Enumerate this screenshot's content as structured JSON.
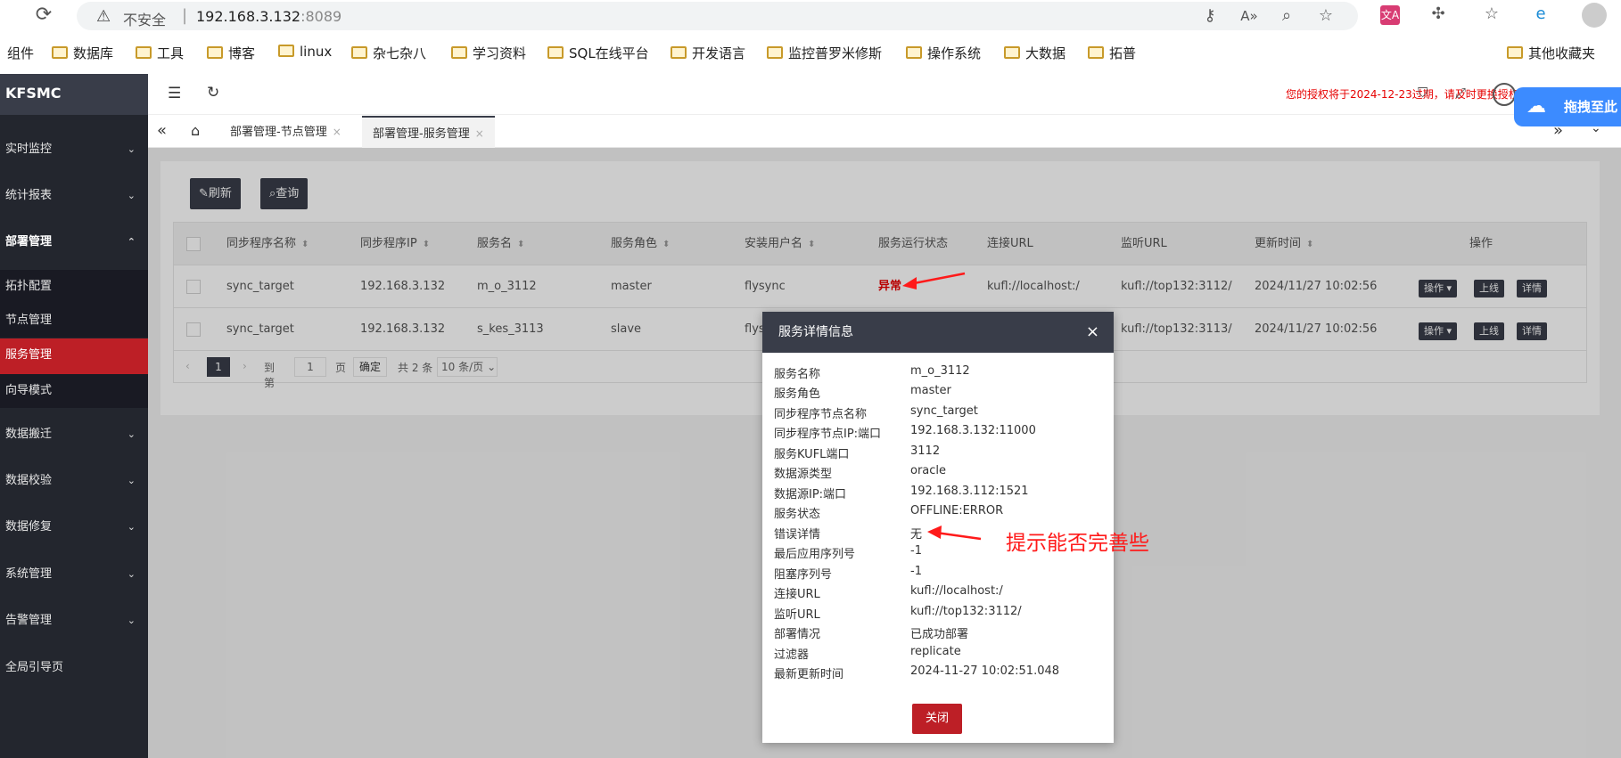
{
  "browser": {
    "insecure_label": "不安全",
    "url_host": "192.168.3.132",
    "url_port": ":8089"
  },
  "bookmarks": [
    "组件",
    "数据库",
    "工具",
    "博客",
    "linux",
    "杂七杂八",
    "学习资料",
    "SQL在线平台",
    "开发语言",
    "监控普罗米修斯",
    "操作系统",
    "大数据",
    "拓普"
  ],
  "bookmarks_other": "其他收藏夹",
  "sidebar": {
    "brand": "KFSMC",
    "items": [
      {
        "label": "实时监控",
        "chev": "⌄"
      },
      {
        "label": "统计报表",
        "chev": "⌄"
      },
      {
        "label": "部署管理",
        "chev": "⌃"
      },
      {
        "label": "数据搬迁",
        "chev": "⌄"
      },
      {
        "label": "数据校验",
        "chev": "⌄"
      },
      {
        "label": "数据修复",
        "chev": "⌄"
      },
      {
        "label": "系统管理",
        "chev": "⌄"
      },
      {
        "label": "告警管理",
        "chev": "⌄"
      },
      {
        "label": "全局引导页",
        "chev": ""
      }
    ],
    "sub_items": [
      "拓扑配置",
      "节点管理",
      "服务管理",
      "向导模式"
    ]
  },
  "header": {
    "license_notice": "您的授权将于2024-12-23过期，请及时更换授权文件"
  },
  "tabs": [
    {
      "label": "部署管理-节点管理",
      "close": "×"
    },
    {
      "label": "部署管理-服务管理",
      "close": "×"
    }
  ],
  "toolbar": {
    "refresh_label": "刷新",
    "query_label": "查询"
  },
  "table": {
    "headers": [
      "同步程序名称",
      "同步程序IP",
      "服务名",
      "服务角色",
      "安装用户名",
      "服务运行状态",
      "连接URL",
      "监听URL",
      "更新时间",
      "操作"
    ],
    "rows": [
      {
        "name": "sync_target",
        "ip": "192.168.3.132",
        "service": "m_o_3112",
        "role": "master",
        "user": "flysync",
        "status": "异常",
        "conn": "kufl://localhost:/",
        "listen": "kufl://top132:3112/",
        "time": "2024/11/27 10:02:56"
      },
      {
        "name": "sync_target",
        "ip": "192.168.3.132",
        "service": "s_kes_3113",
        "role": "slave",
        "user": "flysync",
        "status": "",
        "conn": "",
        "listen": "kufl://top132:3113/",
        "time": "2024/11/27 10:02:56"
      }
    ],
    "ops": {
      "action": "操作 ▾",
      "online": "上线",
      "detail": "详情"
    }
  },
  "pager": {
    "current": "1",
    "goto_label": "到第",
    "goto_value": "1",
    "page_label": "页",
    "confirm": "确定",
    "total": "共 2 条",
    "size": "10 条/页"
  },
  "modal": {
    "title": "服务详情信息",
    "close_x": "×",
    "fields": [
      {
        "label": "服务名称",
        "value": "m_o_3112"
      },
      {
        "label": "服务角色",
        "value": "master"
      },
      {
        "label": "同步程序节点名称",
        "value": "sync_target"
      },
      {
        "label": "同步程序节点IP:端口",
        "value": "192.168.3.132:11000"
      },
      {
        "label": "服务KUFL端口",
        "value": "3112"
      },
      {
        "label": "数据源类型",
        "value": "oracle"
      },
      {
        "label": "数据源IP:端口",
        "value": "192.168.3.112:1521"
      },
      {
        "label": "服务状态",
        "value": "OFFLINE:ERROR"
      },
      {
        "label": "错误详情",
        "value": "无"
      },
      {
        "label": "最后应用序列号",
        "value": "-1"
      },
      {
        "label": "阻塞序列号",
        "value": "-1"
      },
      {
        "label": "连接URL",
        "value": "kufl://localhost:/"
      },
      {
        "label": "监听URL",
        "value": "kufl://top132:3112/"
      },
      {
        "label": "部署情况",
        "value": "已成功部署"
      },
      {
        "label": "过滤器",
        "value": "replicate"
      },
      {
        "label": "最新更新时间",
        "value": "2024-11-27 10:02:51.048"
      }
    ],
    "close_label": "关闭"
  },
  "baidu_label": "拖拽至此",
  "annotation": "提示能否完善些",
  "colors": {
    "accent_red": "#bd1f26",
    "dark": "#393d49",
    "sidebar": "#23262e"
  }
}
